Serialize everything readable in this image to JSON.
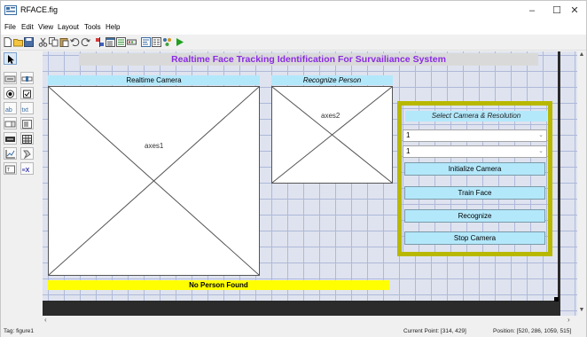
{
  "window": {
    "title": "RFACE.fig",
    "controls": {
      "minimize": "–",
      "maximize": "☐",
      "close": "✕"
    }
  },
  "menu": [
    "File",
    "Edit",
    "View",
    "Layout",
    "Tools",
    "Help"
  ],
  "canvas": {
    "main_title": "Realtime Face Tracking Identification For Survailiance System",
    "camera_panel_label": "Realtime Camera",
    "axes1_label": "axes1",
    "person_panel_label": "Recognize Person",
    "axes2_label": "axes2",
    "status_message": "No Person Found",
    "control_panel": {
      "title": "Select Camera & Resolution",
      "camera_select": "1",
      "resolution_select": "1",
      "buttons": {
        "init": "Initialize Camera",
        "train": "Train Face",
        "recognize": "Recognize",
        "stop": "Stop Camera"
      }
    }
  },
  "statusbar": {
    "tag": "Tag: figure1",
    "current_point": "Current Point:  [314, 429]",
    "position": "Position: [520, 286, 1059, 515]"
  },
  "colors": {
    "title_text": "#8a2be2",
    "label_bg": "#b3e8fb",
    "status_bg": "#ffff00",
    "panel_border": "#b8b800",
    "grid_bg": "#dfe3ef"
  }
}
